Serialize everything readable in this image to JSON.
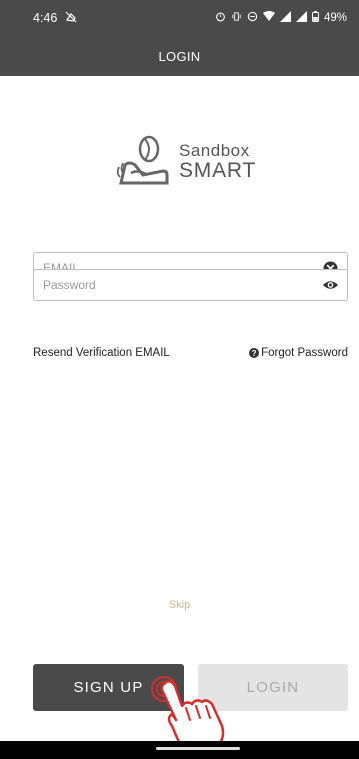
{
  "status_bar": {
    "time": "4:46",
    "battery": "49%"
  },
  "app_bar": {
    "title": "LOGIN"
  },
  "logo": {
    "line1": "Sandbox",
    "line2": "SMART"
  },
  "form": {
    "email_placeholder": "EMAIL",
    "password_placeholder": "Password"
  },
  "links": {
    "resend": "Resend Verification EMAIL",
    "forgot": "Forgot Password"
  },
  "skip_label": "Skip",
  "buttons": {
    "signup": "SIGN UP",
    "login": "LOGIN"
  },
  "colors": {
    "bar": "#4a4a4a",
    "primary_button": "#4a4a4a",
    "disabled_button": "#e4e4e4",
    "skip_text": "#c9b98f",
    "touch_indicator": "#d32f2f"
  },
  "icons": {
    "status_left": "no-sim-icon",
    "status_right": [
      "alarm-icon",
      "vibrate-icon",
      "dnd-icon",
      "wifi-icon",
      "signal-icon",
      "signal-icon",
      "battery-icon"
    ],
    "email_clear": "clear-circle-icon",
    "password_toggle": "eye-icon",
    "forgot": "help-circle-icon"
  }
}
